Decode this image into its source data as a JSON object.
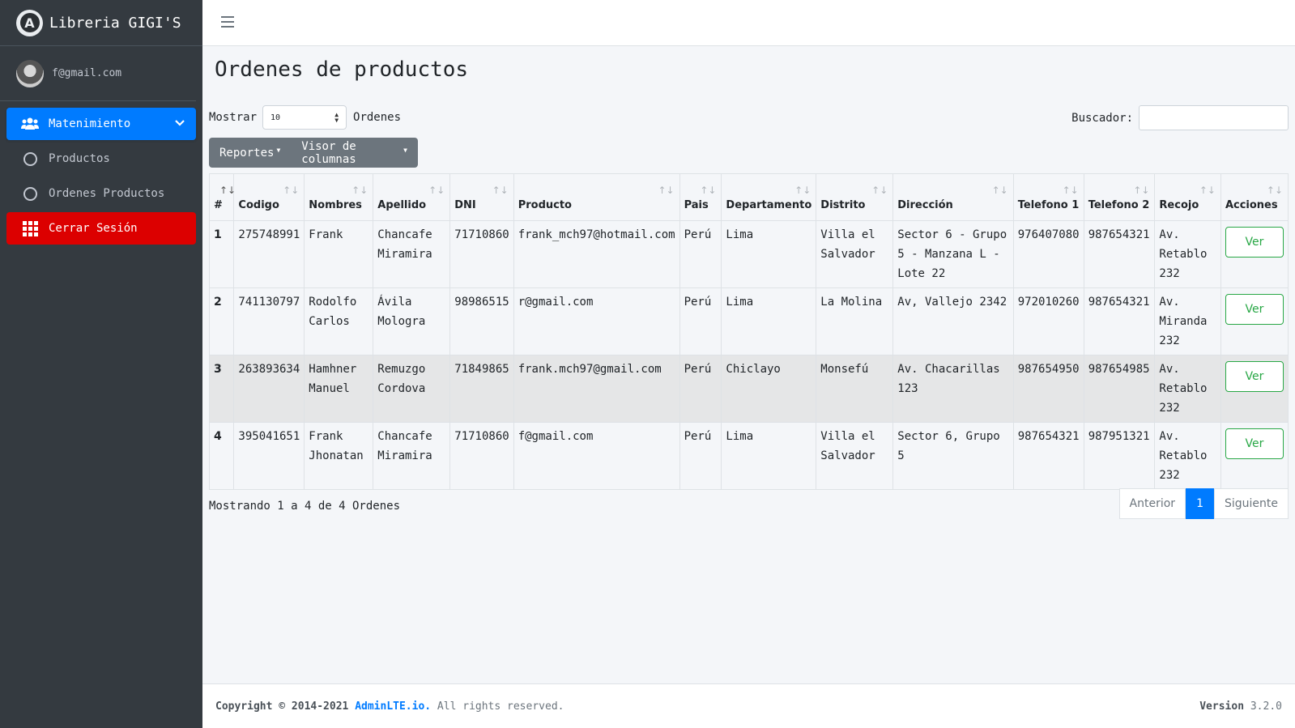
{
  "brand": {
    "name": "Libreria GIGI'S",
    "logo_letter": "A"
  },
  "user": {
    "email": "f@gmail.com"
  },
  "sidebar": {
    "items": [
      {
        "label": "Matenimiento",
        "icon": "users-icon"
      },
      {
        "label": "Productos",
        "icon": "circle-icon"
      },
      {
        "label": "Ordenes Productos",
        "icon": "circle-icon"
      },
      {
        "label": "Cerrar Sesión",
        "icon": "grid-icon"
      }
    ]
  },
  "page": {
    "title": "Ordenes de productos"
  },
  "controls": {
    "show_label": "Mostrar",
    "length_value": "10",
    "length_suffix": "Ordenes",
    "search_label": "Buscador:",
    "search_value": "",
    "reports_label": "Reportes",
    "columns_label": "Visor de columnas"
  },
  "table": {
    "headers": [
      "#",
      "Codigo",
      "Nombres",
      "Apellido",
      "DNI",
      "Producto",
      "Pais",
      "Departamento",
      "Distrito",
      "Dirección",
      "Telefono 1",
      "Telefono 2",
      "Recojo",
      "Acciones"
    ],
    "rows": [
      [
        "1",
        "275748991",
        "Frank",
        "Chancafe Miramira",
        "71710860",
        "frank_mch97@hotmail.com",
        "Perú",
        "Lima",
        "Villa el Salvador",
        "Sector 6 - Grupo 5 - Manzana L - Lote 22",
        "976407080",
        "987654321",
        "Av. Retablo 232",
        "Ver"
      ],
      [
        "2",
        "741130797",
        "Rodolfo Carlos",
        "Ávila Mologra",
        "98986515",
        "r@gmail.com",
        "Perú",
        "Lima",
        "La Molina",
        "Av, Vallejo 2342",
        "972010260",
        "987654321",
        "Av. Miranda 232",
        "Ver"
      ],
      [
        "3",
        "263893634",
        "Hamhner Manuel",
        "Remuzgo Cordova",
        "71849865",
        "frank.mch97@gmail.com",
        "Perú",
        "Chiclayo",
        "Monsefú",
        "Av. Chacarillas 123",
        "987654950",
        "987654985",
        "Av. Retablo 232",
        "Ver"
      ],
      [
        "4",
        "395041651",
        "Frank Jhonatan",
        "Chancafe Miramira",
        "71710860",
        "f@gmail.com",
        "Perú",
        "Lima",
        "Villa el Salvador",
        "Sector 6, Grupo 5",
        "987654321",
        "987951321",
        "Av. Retablo 232",
        "Ver"
      ]
    ]
  },
  "info": "Mostrando 1 a 4 de 4 Ordenes",
  "pagination": {
    "prev": "Anterior",
    "current": "1",
    "next": "Siguiente"
  },
  "footer": {
    "copyright": "Copyright © 2014-2021 ",
    "link": "AdminLTE.io.",
    "rights": " All rights reserved.",
    "version_label": "Version",
    "version": " 3.2.0"
  },
  "colors": {
    "primary": "#007bff",
    "danger": "#dc0000",
    "success": "#28a745",
    "sidebar": "#343a40"
  }
}
